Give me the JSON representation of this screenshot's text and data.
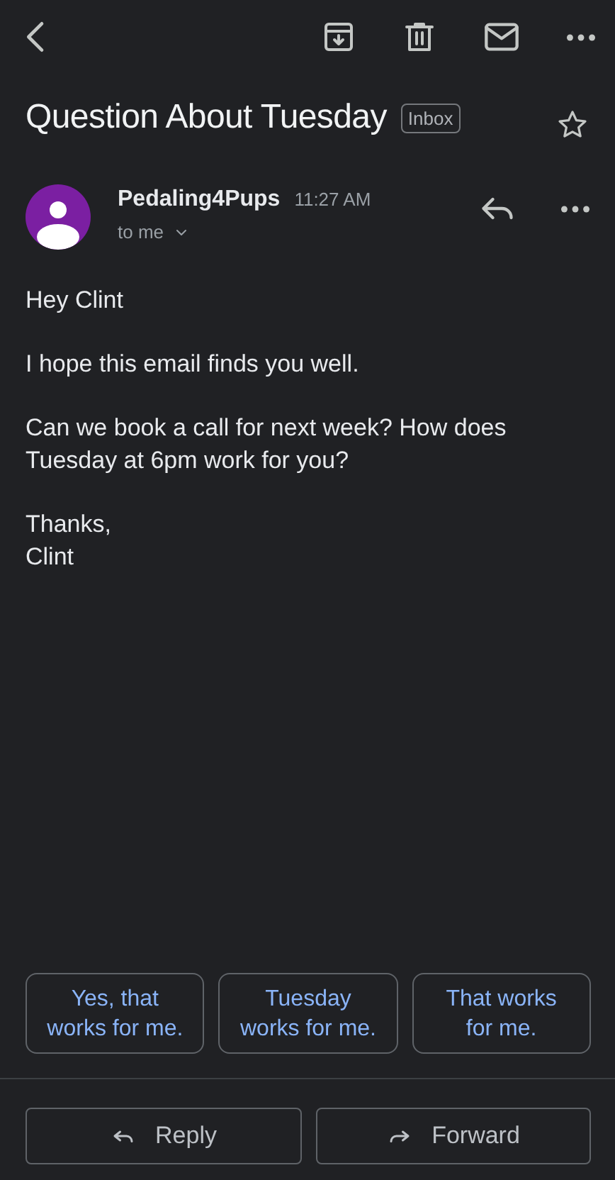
{
  "subject": "Question About Tuesday",
  "label": "Inbox",
  "starred": false,
  "sender": {
    "name": "Pedaling4Pups",
    "time": "11:27 AM",
    "recipient": "to me"
  },
  "body": [
    [
      "Hey Clint"
    ],
    [
      "I hope this email finds you well."
    ],
    [
      "Can we book a call for next week? How does Tuesday at 6pm work for you?"
    ],
    [
      "Thanks,",
      "Clint"
    ]
  ],
  "smart_replies": [
    [
      "Yes, that",
      "works for me."
    ],
    [
      "Tuesday",
      "works for me."
    ],
    [
      "That works",
      "for me."
    ]
  ],
  "actions": [
    {
      "kind": "reply",
      "label": "Reply"
    },
    {
      "kind": "forward",
      "label": "Forward"
    }
  ]
}
